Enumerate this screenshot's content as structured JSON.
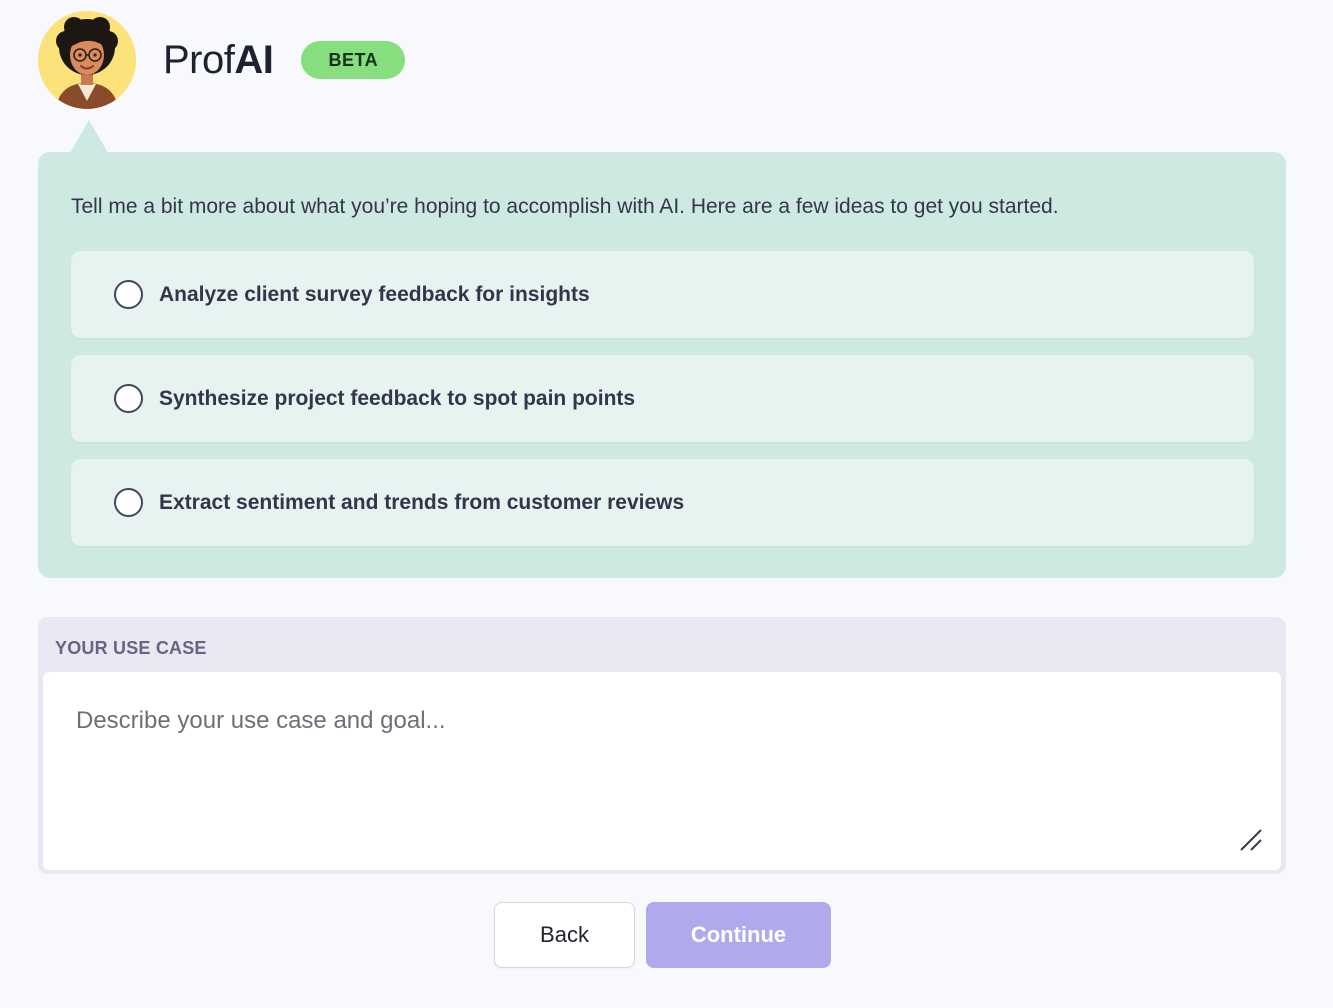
{
  "header": {
    "brand_prefix": "Prof",
    "brand_suffix": "AI",
    "badge": "BETA",
    "avatar_icon": "professor-avatar-icon"
  },
  "prompt": {
    "text": "Tell me a bit more about what you’re hoping to accomplish with AI. Here are a few ideas to get you started."
  },
  "options": [
    {
      "label": "Analyze client survey feedback for insights",
      "selected": false
    },
    {
      "label": "Synthesize project feedback to spot pain points",
      "selected": false
    },
    {
      "label": "Extract sentiment and trends from customer reviews",
      "selected": false
    }
  ],
  "use_case": {
    "label": "YOUR USE CASE",
    "placeholder": "Describe your use case and goal...",
    "value": ""
  },
  "actions": {
    "back_label": "Back",
    "continue_label": "Continue"
  },
  "colors": {
    "badge": "#86de7f",
    "panel": "#cee9e2",
    "option": "#e6f3f0",
    "continue_disabled": "#aeaaec",
    "usecase_panel": "#e9e7f2"
  }
}
